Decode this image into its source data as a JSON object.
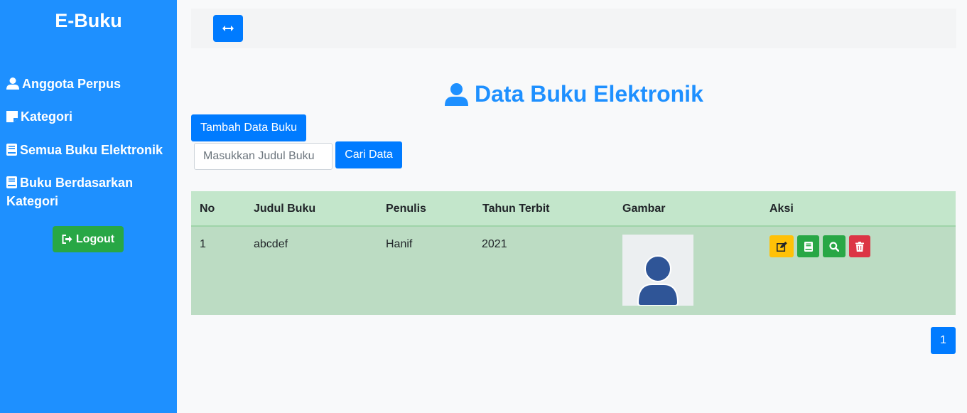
{
  "sidebar": {
    "brand": "E-Buku",
    "items": [
      {
        "label": "Anggota Perpus",
        "icon": "user-icon"
      },
      {
        "label": "Kategori",
        "icon": "sticky-note-icon"
      },
      {
        "label": "Semua Buku Elektronik",
        "icon": "book-icon"
      },
      {
        "label": "Buku Berdasarkan Kategori",
        "icon": "book-icon"
      }
    ],
    "logout_label": "Logout"
  },
  "page": {
    "title": "Data Buku Elektronik",
    "add_label": "Tambah Data Buku",
    "search": {
      "placeholder": "Masukkan Judul Buku",
      "value": "",
      "button_label": "Cari Data"
    }
  },
  "table": {
    "headers": [
      "No",
      "Judul Buku",
      "Penulis",
      "Tahun Terbit",
      "Gambar",
      "Aksi"
    ],
    "rows": [
      {
        "no": "1",
        "judul": "abcdef",
        "penulis": "Hanif",
        "tahun": "2021",
        "gambar": "avatar-placeholder"
      }
    ]
  },
  "pagination": {
    "current": "1"
  },
  "colors": {
    "sidebar": "#1e90ff",
    "primary": "#007bff",
    "success": "#28a745",
    "warning": "#ffc107",
    "danger": "#dc3545",
    "table_header": "#c3e6cb",
    "table_row": "#bcdcc3"
  }
}
